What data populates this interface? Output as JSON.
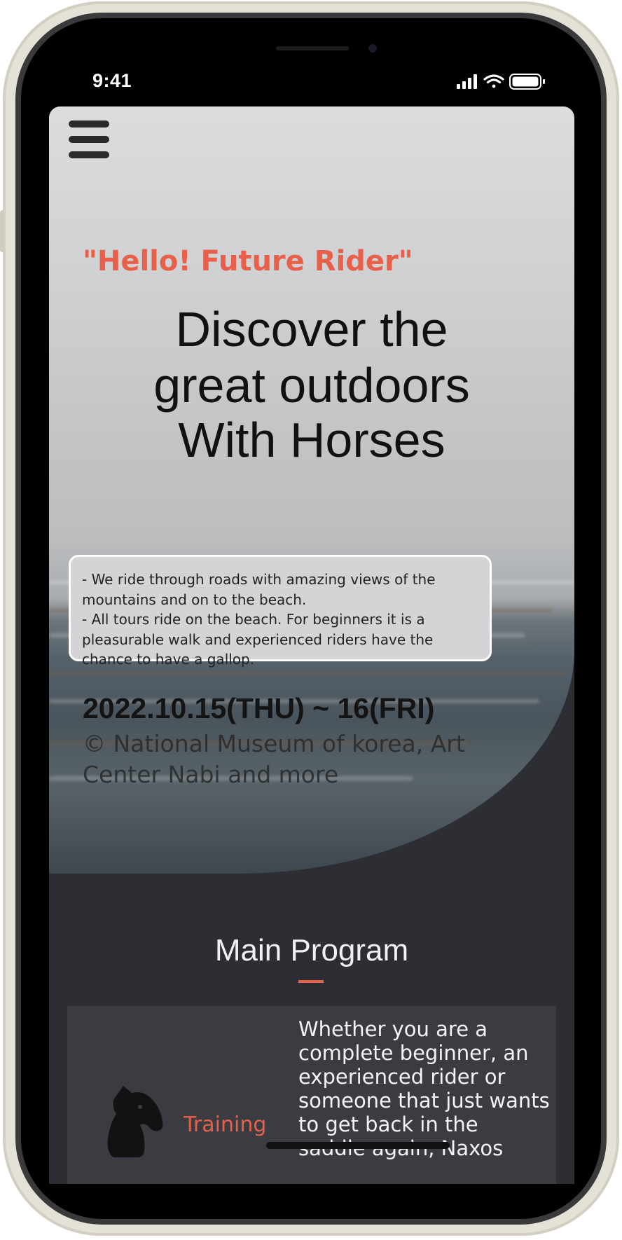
{
  "status_bar": {
    "time": "9:41"
  },
  "hero": {
    "greeting": "\"Hello! Future Rider\"",
    "headline_lines": [
      "Discover the",
      "great outdoors",
      "With Horses"
    ],
    "info_lines": [
      "- We ride through roads with amazing views of the mountains and on to the beach.",
      "- All tours ride on the beach. For beginners it is a pleasurable walk and experienced riders have the chance to have a gallop."
    ],
    "date": "2022.10.15(THU) ~ 16(FRI)",
    "credit": "© National Museum of korea, Art Center Nabi and more"
  },
  "main_program": {
    "title": "Main Program",
    "items": [
      {
        "icon": "horse-head-icon",
        "label": "Training",
        "description": "Whether you are a complete beginner, an experienced rider or someone that just wants to get back in the saddle again, Naxos"
      }
    ]
  },
  "colors": {
    "accent": "#e8604a",
    "headline_gradient": "#e0661c",
    "dark_background": "#2c2e33",
    "card_background": "#3a3c41"
  }
}
